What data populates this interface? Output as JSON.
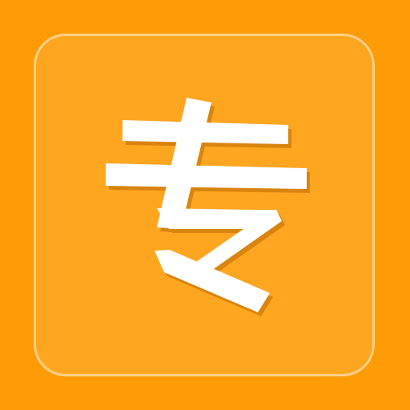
{
  "app_icon": {
    "glyph": "专",
    "background_color": "#FF9B05",
    "tile_color": "#FFA621",
    "tile_border_color": "#FFD696",
    "glyph_color": "#FFFFFF",
    "glyph_shadow_color": "#B96A00"
  }
}
